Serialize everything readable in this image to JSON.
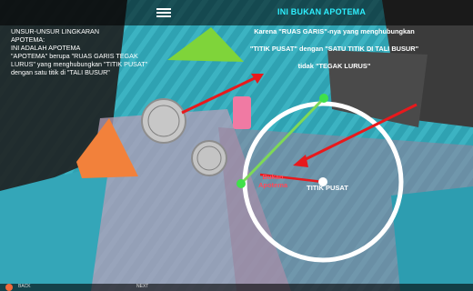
{
  "header": {
    "title": "INI BUKAN APOTEMA"
  },
  "left_panel": {
    "lines": [
      "UNSUR-UNSUR LINGKARAN",
      "APOTEMA:",
      "",
      "INI ADALAH APOTEMA",
      "\"APOTEMA\" berupa \"RUAS GARIS TEGAK",
      "LURUS\" yang menghubungkan \"TITIK PUSAT\"",
      "dengan satu titik di \"TALI BUSUR\""
    ]
  },
  "right_panel": {
    "line1": "Karena \"RUAS GARIS\"-nya yang menghubungkan",
    "line2": "\"TITIK PUSAT\" dengan \"SATU TITIK DI TALI BUSUR\"",
    "line3": "tidak \"TEGAK LURUS\""
  },
  "labels": {
    "bukan_apotema": "Bukan\nApotema",
    "titik_pusat": "TITIK PUSAT"
  },
  "colors": {
    "title": "#2ef0ff",
    "circle": "#ffffff",
    "chord": "#7ed957",
    "chord_point": "#3fe04a",
    "arrow": "#e8191c",
    "bukan_label": "#ff4a5a",
    "center_point": "#ffffff"
  },
  "icons": {
    "menu": "hamburger-menu-icon",
    "corner": "app-corner-icon"
  },
  "footer": {
    "left": "BACK",
    "right": "NEXT"
  }
}
